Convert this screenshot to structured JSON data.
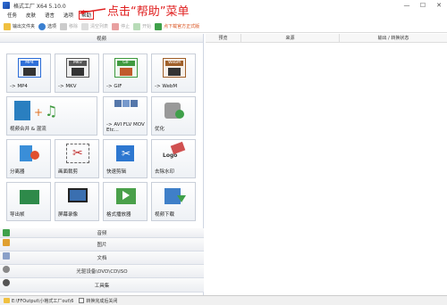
{
  "window": {
    "title": "格式工厂 X64 5.10.0",
    "minimize_glyph": "—",
    "maximize_glyph": "☐",
    "close_glyph": "✕"
  },
  "menu": {
    "items": [
      "任务",
      "皮肤",
      "语言",
      "选项",
      "帮助"
    ]
  },
  "annotation": {
    "text": "点击“帮助”菜单",
    "color": "#e02020"
  },
  "toolbar": {
    "output_folder": "输出文件夹",
    "options": "选项",
    "remove": "移除",
    "clear_list": "清空列表",
    "stop": "停止",
    "start": "开始",
    "download_link": "点下载官方正式版"
  },
  "sections": {
    "video": "视频",
    "audio": "音频",
    "image": "图片",
    "document": "文档",
    "optical": "光驱设备\\DVD\\CD\\ISO",
    "toolbox": "工具集"
  },
  "tiles": [
    {
      "label": "-> MP4",
      "badge": "MP4",
      "color": "#2f6fd8"
    },
    {
      "label": "-> MKV",
      "badge": "MKV",
      "color": "#555555"
    },
    {
      "label": "-> GIF",
      "badge": "GIF",
      "color": "#3f9a3f"
    },
    {
      "label": "-> WebM",
      "badge": "WebM",
      "color": "#a0602a"
    },
    {
      "label": "视频合并 & 混流",
      "badge": "",
      "color": "#2a7fc0"
    },
    {
      "label": "-> AVI FLV MOV Etc...",
      "badge": "",
      "color": "#5577aa"
    },
    {
      "label": "优化",
      "badge": "",
      "color": "#777777"
    },
    {
      "label": "分离器",
      "badge": "",
      "color": "#3a8ed8"
    },
    {
      "label": "画面裁剪",
      "badge": "",
      "color": "#888888"
    },
    {
      "label": "快速剪辑",
      "badge": "",
      "color": "#2d77d0"
    },
    {
      "label": "去除水印",
      "badge": "Logo",
      "color": "#d05050"
    },
    {
      "label": "导出帧",
      "badge": "",
      "color": "#2e8a4a"
    },
    {
      "label": "屏幕录像",
      "badge": "",
      "color": "#3a6fb0"
    },
    {
      "label": "格式播放器",
      "badge": "",
      "color": "#4aa04a"
    },
    {
      "label": "视频下载",
      "badge": "",
      "color": "#3f7fc8"
    }
  ],
  "right_pane": {
    "columns": [
      "预览",
      "来源",
      "输出 / 转换状态"
    ]
  },
  "status": {
    "path": "E:\\FFOutput\\小格式工厂out\\6",
    "shutdown_label": "转换完成后关闭"
  }
}
